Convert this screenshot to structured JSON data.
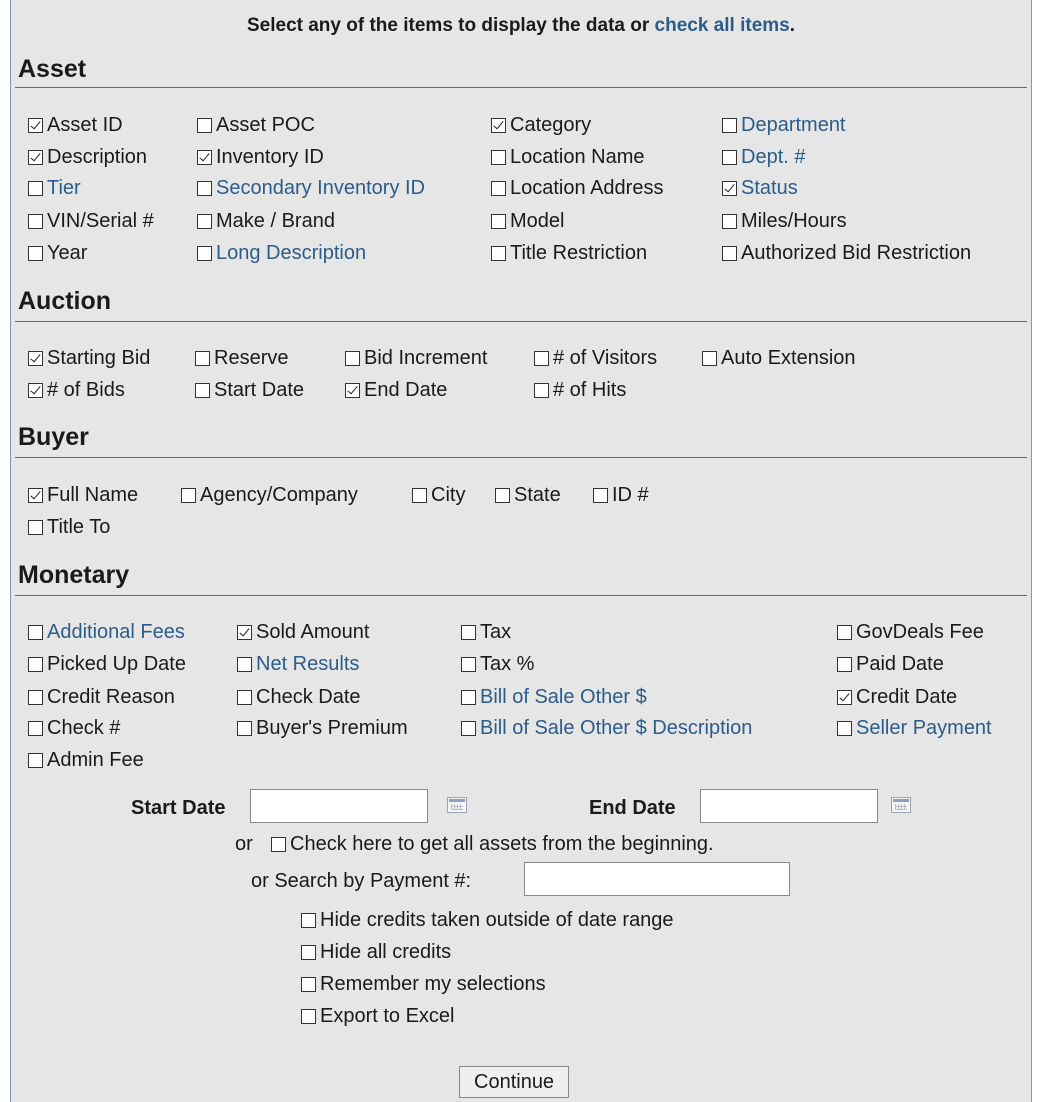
{
  "header": {
    "prefix": "Select any of the items to display the data or ",
    "link": "check all items",
    "suffix": "."
  },
  "sections": {
    "asset": "Asset",
    "auction": "Auction",
    "buyer": "Buyer",
    "monetary": "Monetary"
  },
  "asset": {
    "asset_id": {
      "label": "Asset ID",
      "checked": true
    },
    "asset_poc": {
      "label": "Asset POC",
      "checked": false
    },
    "category": {
      "label": "Category",
      "checked": true
    },
    "department": {
      "label": "Department",
      "checked": false
    },
    "description": {
      "label": "Description",
      "checked": true
    },
    "inventory_id": {
      "label": "Inventory ID",
      "checked": true
    },
    "location_name": {
      "label": "Location Name",
      "checked": false
    },
    "dept_num": {
      "label": "Dept. #",
      "checked": false
    },
    "tier": {
      "label": "Tier",
      "checked": false
    },
    "secondary_inventory_id": {
      "label": "Secondary Inventory ID",
      "checked": false
    },
    "location_address": {
      "label": "Location Address",
      "checked": false
    },
    "status": {
      "label": "Status",
      "checked": true
    },
    "vin_serial": {
      "label": "VIN/Serial #",
      "checked": false
    },
    "make_brand": {
      "label": "Make / Brand",
      "checked": false
    },
    "model": {
      "label": "Model",
      "checked": false
    },
    "miles_hours": {
      "label": "Miles/Hours",
      "checked": false
    },
    "year": {
      "label": "Year",
      "checked": false
    },
    "long_description": {
      "label": "Long Description",
      "checked": false
    },
    "title_restriction": {
      "label": "Title Restriction",
      "checked": false
    },
    "authorized_bid_restriction": {
      "label": "Authorized Bid Restriction",
      "checked": false
    }
  },
  "auction": {
    "starting_bid": {
      "label": "Starting Bid",
      "checked": true
    },
    "reserve": {
      "label": "Reserve",
      "checked": false
    },
    "bid_increment": {
      "label": "Bid Increment",
      "checked": false
    },
    "num_visitors": {
      "label": "# of Visitors",
      "checked": false
    },
    "auto_extension": {
      "label": "Auto Extension",
      "checked": false
    },
    "num_bids": {
      "label": "# of Bids",
      "checked": true
    },
    "start_date": {
      "label": "Start Date",
      "checked": false
    },
    "end_date": {
      "label": "End Date",
      "checked": true
    },
    "num_hits": {
      "label": "# of Hits",
      "checked": false
    }
  },
  "buyer": {
    "full_name": {
      "label": "Full Name",
      "checked": true
    },
    "agency_company": {
      "label": "Agency/Company",
      "checked": false
    },
    "city": {
      "label": "City",
      "checked": false
    },
    "state": {
      "label": "State",
      "checked": false
    },
    "id_num": {
      "label": "ID #",
      "checked": false
    },
    "title_to": {
      "label": "Title To",
      "checked": false
    }
  },
  "monetary": {
    "additional_fees": {
      "label": "Additional Fees",
      "checked": false
    },
    "sold_amount": {
      "label": "Sold Amount",
      "checked": true
    },
    "tax": {
      "label": "Tax",
      "checked": false
    },
    "govdeals_fee": {
      "label": "GovDeals Fee",
      "checked": false
    },
    "picked_up_date": {
      "label": "Picked Up Date",
      "checked": false
    },
    "net_results": {
      "label": "Net Results",
      "checked": false
    },
    "tax_pct": {
      "label": "Tax %",
      "checked": false
    },
    "paid_date": {
      "label": "Paid Date",
      "checked": false
    },
    "credit_reason": {
      "label": "Credit Reason",
      "checked": false
    },
    "check_date": {
      "label": "Check Date",
      "checked": false
    },
    "bill_of_sale_other": {
      "label": "Bill of Sale Other $",
      "checked": false
    },
    "credit_date": {
      "label": "Credit Date",
      "checked": true
    },
    "check_num": {
      "label": "Check #",
      "checked": false
    },
    "buyers_premium": {
      "label": "Buyer's Premium",
      "checked": false
    },
    "bill_of_sale_other_desc": {
      "label": "Bill of Sale Other $ Description",
      "checked": false
    },
    "seller_payment": {
      "label": "Seller Payment",
      "checked": false
    },
    "admin_fee": {
      "label": "Admin Fee",
      "checked": false
    }
  },
  "dates": {
    "start_label": "Start Date",
    "start_value": "",
    "end_label": "End Date",
    "end_value": "",
    "or1": "or",
    "all_assets": {
      "label": "Check here to get all assets from the beginning.",
      "checked": false
    },
    "payment_label": "or Search by Payment #:",
    "payment_value": ""
  },
  "options": {
    "hide_outside": {
      "label": "Hide credits taken outside of date range",
      "checked": false
    },
    "hide_all": {
      "label": "Hide all credits",
      "checked": false
    },
    "remember": {
      "label": "Remember my selections",
      "checked": false
    },
    "export_excel": {
      "label": "Export to Excel",
      "checked": false
    }
  },
  "continue_label": "Continue",
  "colors": {
    "link": "#2b5c8a",
    "panel": "#e6e6e6",
    "rule": "#4a6b8c"
  }
}
